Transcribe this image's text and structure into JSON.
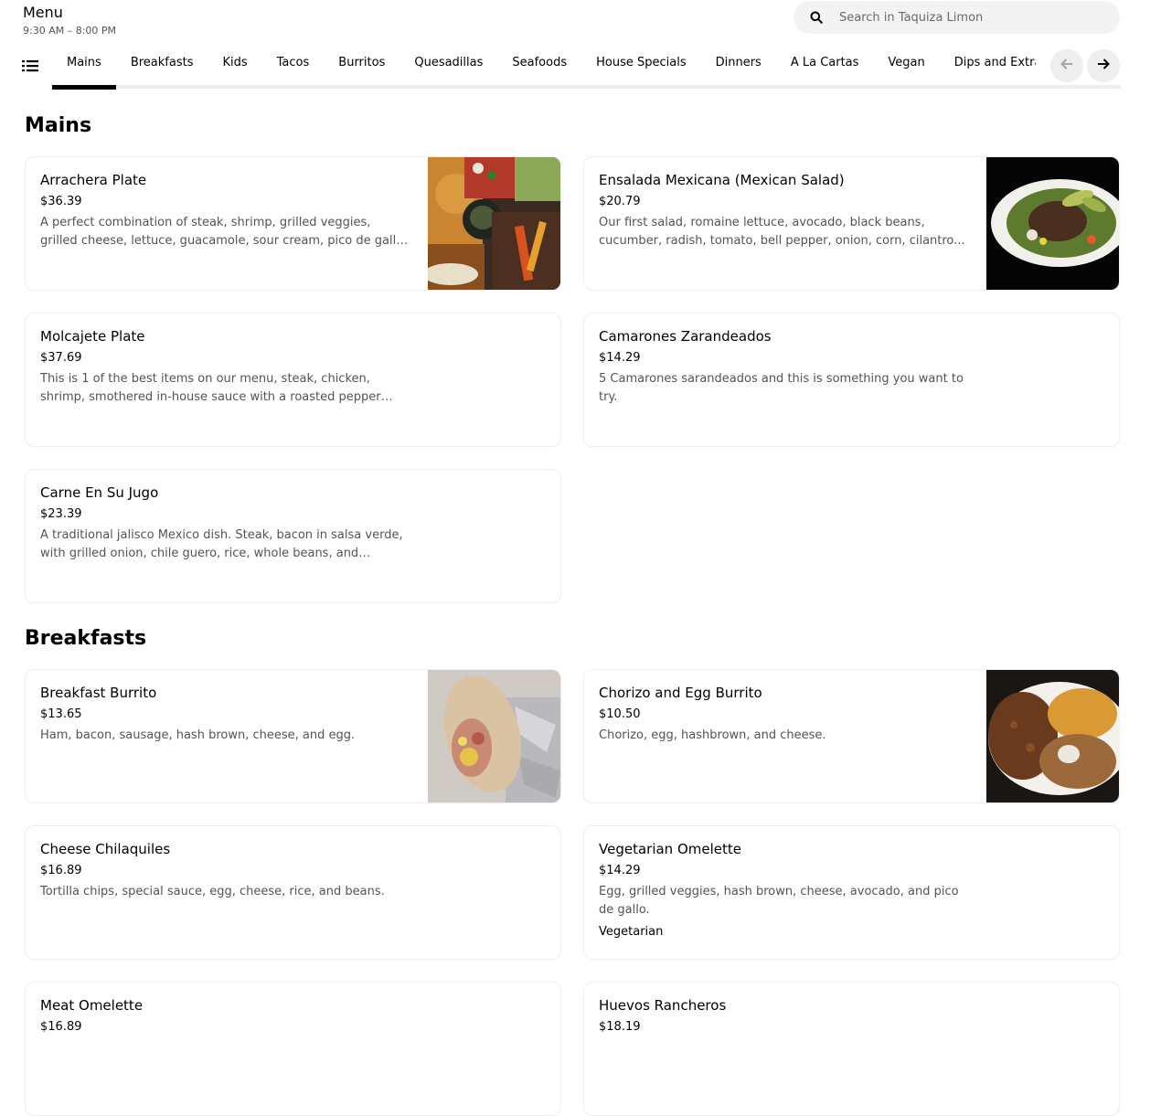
{
  "header": {
    "title": "Menu",
    "hours": "9:30 AM – 8:00 PM"
  },
  "search": {
    "placeholder": "Search in Taquiza Limon",
    "icon": "search-icon"
  },
  "nav": {
    "list_icon": "list-icon",
    "tabs": [
      "Mains",
      "Breakfasts",
      "Kids",
      "Tacos",
      "Burritos",
      "Quesadillas",
      "Seafoods",
      "House Specials",
      "Dinners",
      "A La Cartas",
      "Vegan",
      "Dips and Extras"
    ],
    "active_tab": "Mains",
    "prev_icon": "arrow-left-icon",
    "next_icon": "arrow-right-icon"
  },
  "colors": {
    "text_primary": "#000000",
    "text_secondary": "#545454",
    "card_border": "#eeeeee",
    "search_bg": "#f3f3f3",
    "button_bg": "#eeeeee"
  },
  "sections": [
    {
      "title": "Mains",
      "items": [
        {
          "name": "Arrachera Plate",
          "price": "$36.39",
          "description": "A perfect combination of steak, shrimp, grilled veggies, grilled cheese, lettuce, guacamole, sour cream, pico de gallo, rice,...",
          "image": "arrachera-plate-photo"
        },
        {
          "name": "Ensalada Mexicana (Mexican Salad)",
          "price": "$20.79",
          "description": "Our first salad, romaine lettuce, avocado, black beans, cucumber, radish, tomato, bell pepper, onion, corn, cilantro...",
          "image": "mexican-salad-photo"
        },
        {
          "name": "Molcajete Plate",
          "price": "$37.69",
          "description": "This is 1 of the best items on our menu, steak, chicken, shrimp, smothered in-house sauce with a roasted pepper wrapped in..."
        },
        {
          "name": "Camarones Zarandeados",
          "price": "$14.29",
          "description": "5 Camarones sarandeados and this is something you want to try."
        },
        {
          "name": "Carne En Su Jugo",
          "price": "$23.39",
          "description": "A traditional jalisco Mexico dish. Steak, bacon in salsa verde, with grilled onion, chile guero, rice, whole beans, and tortillas."
        }
      ]
    },
    {
      "title": "Breakfasts",
      "items": [
        {
          "name": "Breakfast Burrito",
          "price": "$13.65",
          "description": "Ham, bacon, sausage, hash brown, cheese, and egg.",
          "image": "breakfast-burrito-photo"
        },
        {
          "name": "Chorizo and Egg Burrito",
          "price": "$10.50",
          "description": "Chorizo, egg, hashbrown, and cheese.",
          "image": "chorizo-egg-burrito-photo"
        },
        {
          "name": "Cheese Chilaquiles",
          "price": "$16.89",
          "description": "Tortilla chips, special sauce, egg, cheese, rice, and beans."
        },
        {
          "name": "Vegetarian Omelette",
          "price": "$14.29",
          "description": "Egg, grilled veggies, hash brown, cheese, avocado, and pico de gallo.",
          "tag": "Vegetarian"
        },
        {
          "name": "Meat Omelette",
          "price": "$16.89"
        },
        {
          "name": "Huevos Rancheros",
          "price": "$18.19"
        }
      ]
    }
  ]
}
